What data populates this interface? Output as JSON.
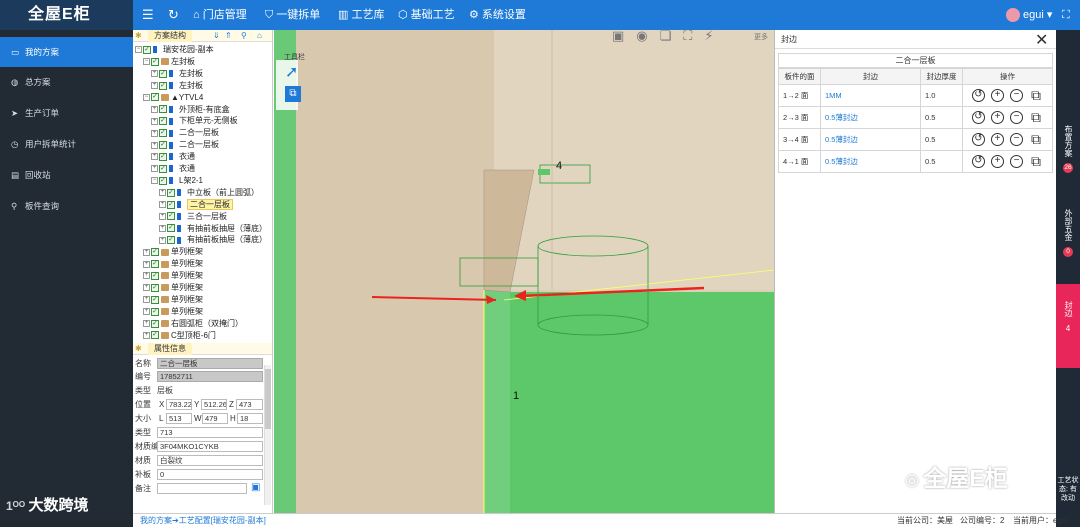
{
  "app": {
    "logo": "全屋E柜",
    "menu": [
      {
        "icon": "home-icon",
        "label": "门店管理"
      },
      {
        "icon": "shield-icon",
        "label": "一键拆单"
      },
      {
        "icon": "bars-icon",
        "label": "工艺库"
      },
      {
        "icon": "cube-icon",
        "label": "基础工艺"
      },
      {
        "icon": "gear-icon",
        "label": "系统设置"
      }
    ],
    "user": "egui"
  },
  "sidebar": {
    "items": [
      {
        "icon": "monitor-icon",
        "label": "我的方案"
      },
      {
        "icon": "globe-icon",
        "label": "总方案"
      },
      {
        "icon": "send-icon",
        "label": "生产订单"
      },
      {
        "icon": "clock-icon",
        "label": "用户拆单统计"
      },
      {
        "icon": "trash-icon",
        "label": "回收站"
      },
      {
        "icon": "search-icon",
        "label": "板件查询"
      }
    ]
  },
  "tree": {
    "title": "方案结构",
    "nodes": [
      {
        "label": "瑞安花园-副本",
        "indent": 0,
        "icon": "flag"
      },
      {
        "label": "左封板",
        "indent": 1,
        "icon": "box"
      },
      {
        "label": "左封板",
        "indent": 2,
        "icon": "flag"
      },
      {
        "label": "左封板",
        "indent": 2,
        "icon": "flag"
      },
      {
        "label": "▲YTVL4",
        "indent": 1,
        "icon": "box"
      },
      {
        "label": "外顶柜-有底盒",
        "indent": 2,
        "icon": "flag"
      },
      {
        "label": "下柜单元-无侧板",
        "indent": 2,
        "icon": "flag"
      },
      {
        "label": "二合一层板",
        "indent": 2,
        "icon": "flag"
      },
      {
        "label": "二合一层板",
        "indent": 2,
        "icon": "flag"
      },
      {
        "label": "衣通",
        "indent": 2,
        "icon": "flag"
      },
      {
        "label": "衣通",
        "indent": 2,
        "icon": "flag"
      },
      {
        "label": "L架2-1",
        "indent": 2,
        "icon": "flag"
      },
      {
        "label": "中立板（前上圆弧）",
        "indent": 3,
        "icon": "flag"
      },
      {
        "label": "二合一层板",
        "indent": 3,
        "icon": "flag",
        "selected": true
      },
      {
        "label": "三合一层板",
        "indent": 3,
        "icon": "flag"
      },
      {
        "label": "有抽前板抽屉（薄底）",
        "indent": 3,
        "icon": "flag"
      },
      {
        "label": "有抽前板抽屉（薄底）",
        "indent": 3,
        "icon": "flag"
      },
      {
        "label": "单列框架",
        "indent": 1,
        "icon": "box"
      },
      {
        "label": "单列框架",
        "indent": 1,
        "icon": "box"
      },
      {
        "label": "单列框架",
        "indent": 1,
        "icon": "box"
      },
      {
        "label": "单列框架",
        "indent": 1,
        "icon": "box"
      },
      {
        "label": "单列框架",
        "indent": 1,
        "icon": "box"
      },
      {
        "label": "单列框架",
        "indent": 1,
        "icon": "box"
      },
      {
        "label": "右圆弧柜（双掩门）",
        "indent": 1,
        "icon": "box"
      },
      {
        "label": "C型顶柜-6门",
        "indent": 1,
        "icon": "box"
      }
    ]
  },
  "props": {
    "title": "属性信息",
    "name_label": "名称",
    "name": "二合一层板",
    "id_label": "编号",
    "id": "17852711",
    "type_label": "类型",
    "type": "层板",
    "pos_label": "位置",
    "x": "783.22",
    "y": "512.26",
    "z": "473",
    "size_label": "大小",
    "l": "513",
    "w": "479",
    "h": "18",
    "cat_label": "类型",
    "cat": "713",
    "matid_label": "材质编",
    "matid": "3F04MKO1CYKB",
    "mat_label": "材质",
    "mat": "白裂纹",
    "edge_label": "补板",
    "edge": "0",
    "note_label": "备注",
    "note": ""
  },
  "viewport": {
    "toolbar_label": "工具栏",
    "more_label": "更多",
    "marker_4": "4",
    "marker_1": "1",
    "watermark": "全屋E柜",
    "corner_text": "工艺状态: 有改动"
  },
  "edge_panel": {
    "title": "封边",
    "subtitle": "二合一层板",
    "headers": [
      "板件的面",
      "封边",
      "封边厚度",
      "操作"
    ],
    "rows": [
      {
        "face": "1→2 面",
        "edge": "1MM",
        "thickness": "1.0"
      },
      {
        "face": "2→3 面",
        "edge": "0.5薄封边",
        "thickness": "0.5"
      },
      {
        "face": "3→4 面",
        "edge": "0.5薄封边",
        "thickness": "0.5"
      },
      {
        "face": "4→1 面",
        "edge": "0.5薄封边",
        "thickness": "0.5"
      }
    ]
  },
  "right_tabs": [
    {
      "label": "布置方案",
      "count": "26"
    },
    {
      "label": "外部五金",
      "count": "0"
    },
    {
      "label": "封边",
      "count": "4"
    }
  ],
  "bottom": {
    "breadcrumb_a": "我的方案",
    "breadcrumb_b": "工艺配置[瑞安花园-副本]",
    "company_label": "当前公司：",
    "company": "美屋",
    "company_no_label": "公司编号：",
    "company_no": "2",
    "user_label": "当前用户：",
    "user": "egui",
    "brand_overlay": "大数跨境"
  },
  "colors": {
    "accent": "#1e7ad6",
    "sidebar": "#222a33",
    "green": "#5cc86a",
    "badge": "#e83a52"
  }
}
